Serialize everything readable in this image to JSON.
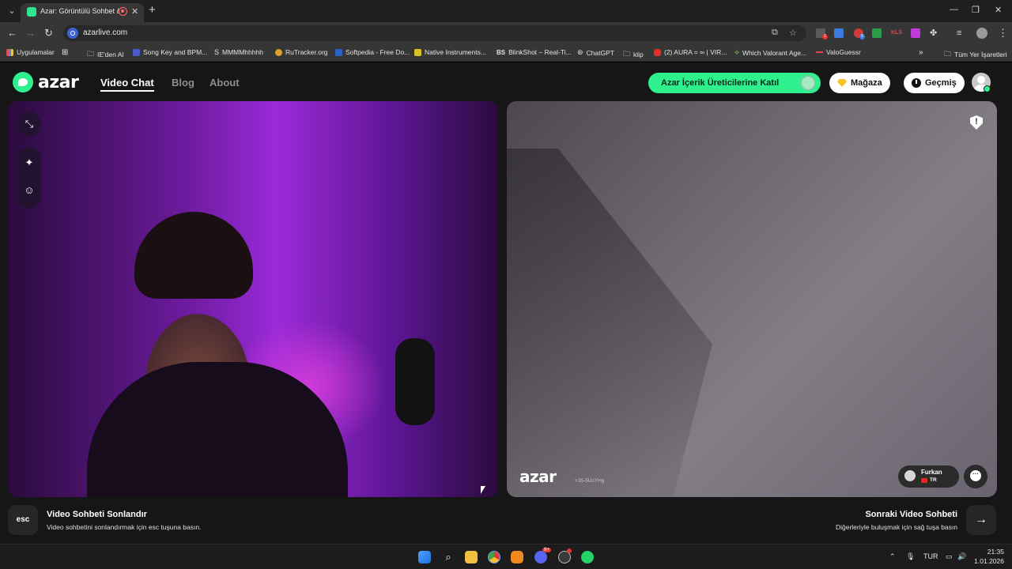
{
  "browser": {
    "tab_title": "Azar: Görüntülü Sohbet & V",
    "url": "azarlive.com",
    "bookmarks": [
      "Uygulamalar",
      "IE'den Al",
      "Song Key and BPM...",
      "MMMMhhhhh",
      "RuTracker.org",
      "Softpedia - Free Do...",
      "Native Instruments...",
      "BlinkShot – Real-Ti...",
      "ChatGPT",
      "klip",
      "(2) AURA = ∞ | VIR...",
      "Which Valorant Age...",
      "ValoGuessr"
    ],
    "all_bookmarks": "Tüm Yer İşaretleri",
    "extension_badges": [
      "1",
      "5"
    ]
  },
  "header": {
    "logo": "azar",
    "nav": [
      "Video Chat",
      "Blog",
      "About"
    ],
    "creator_cta": "Azar İçerik Üreticilerine Katıl",
    "shop": "Mağaza",
    "history": "Geçmiş"
  },
  "remote": {
    "watermark": "azar",
    "watermark_id": "+35-5UcYHg",
    "username": "Furkan",
    "country": "TR"
  },
  "footer": {
    "esc_key": "esc",
    "end_title": "Video Sohbeti Sonlandır",
    "end_sub": "Video sohbetini sonlandırmak için esc tuşuna basın.",
    "next_title": "Sonraki Video Sohbeti",
    "next_sub": "Diğerleriyle buluşmak için sağ tuşa basın"
  },
  "taskbar": {
    "lang": "TUR",
    "time": "21:35",
    "date": "1.01.2026",
    "discord_badge": "9+"
  },
  "colors": {
    "accent": "#2ef08c",
    "page_bg": "#161616"
  }
}
